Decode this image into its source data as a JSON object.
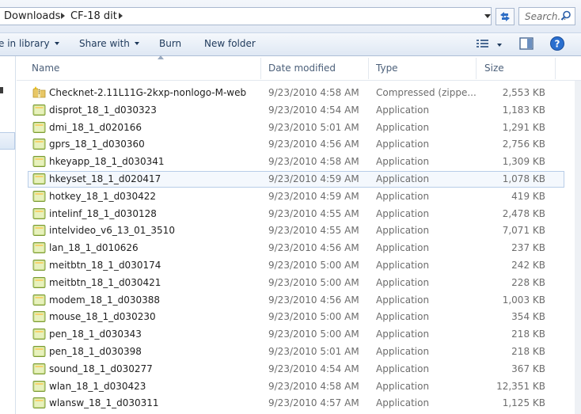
{
  "address": {
    "crumbs": [
      "Downloads",
      "CF-18 dit"
    ]
  },
  "search": {
    "placeholder": "Search..."
  },
  "toolbar": {
    "include_library": "e in library",
    "share_with": "Share with",
    "burn": "Burn",
    "new_folder": "New folder"
  },
  "columns": {
    "name": "Name",
    "date": "Date modified",
    "type": "Type",
    "size": "Size"
  },
  "files": [
    {
      "name": "Checknet-2.11L11G-2kxp-nonlogo-M-web",
      "date": "9/23/2010 4:58 AM",
      "type": "Compressed (zippe...",
      "size": "2,553 KB",
      "icon": "zip-folder-icon"
    },
    {
      "name": "disprot_18_1_d030323",
      "date": "9/23/2010 4:54 AM",
      "type": "Application",
      "size": "1,183 KB",
      "icon": "application-icon"
    },
    {
      "name": "dmi_18_1_d020166",
      "date": "9/23/2010 5:01 AM",
      "type": "Application",
      "size": "1,291 KB",
      "icon": "application-icon"
    },
    {
      "name": "gprs_18_1_d030360",
      "date": "9/23/2010 4:56 AM",
      "type": "Application",
      "size": "2,756 KB",
      "icon": "application-icon"
    },
    {
      "name": "hkeyapp_18_1_d030341",
      "date": "9/23/2010 4:58 AM",
      "type": "Application",
      "size": "1,309 KB",
      "icon": "application-icon"
    },
    {
      "name": "hkeyset_18_1_d020417",
      "date": "9/23/2010 4:59 AM",
      "type": "Application",
      "size": "1,078 KB",
      "icon": "application-icon"
    },
    {
      "name": "hotkey_18_1_d030422",
      "date": "9/23/2010 4:59 AM",
      "type": "Application",
      "size": "419 KB",
      "icon": "application-icon"
    },
    {
      "name": "intelinf_18_1_d030128",
      "date": "9/23/2010 4:55 AM",
      "type": "Application",
      "size": "2,478 KB",
      "icon": "application-icon"
    },
    {
      "name": "intelvideo_v6_13_01_3510",
      "date": "9/23/2010 4:55 AM",
      "type": "Application",
      "size": "7,071 KB",
      "icon": "application-icon"
    },
    {
      "name": "lan_18_1_d010626",
      "date": "9/23/2010 4:56 AM",
      "type": "Application",
      "size": "237 KB",
      "icon": "application-icon"
    },
    {
      "name": "meitbtn_18_1_d030174",
      "date": "9/23/2010 5:00 AM",
      "type": "Application",
      "size": "242 KB",
      "icon": "application-icon"
    },
    {
      "name": "meitbtn_18_1_d030421",
      "date": "9/23/2010 5:00 AM",
      "type": "Application",
      "size": "228 KB",
      "icon": "application-icon"
    },
    {
      "name": "modem_18_1_d030388",
      "date": "9/23/2010 4:56 AM",
      "type": "Application",
      "size": "1,003 KB",
      "icon": "application-icon"
    },
    {
      "name": "mouse_18_1_d030230",
      "date": "9/23/2010 5:00 AM",
      "type": "Application",
      "size": "354 KB",
      "icon": "application-icon"
    },
    {
      "name": "pen_18_1_d030343",
      "date": "9/23/2010 5:00 AM",
      "type": "Application",
      "size": "218 KB",
      "icon": "application-icon"
    },
    {
      "name": "pen_18_1_d030398",
      "date": "9/23/2010 5:01 AM",
      "type": "Application",
      "size": "218 KB",
      "icon": "application-icon"
    },
    {
      "name": "sound_18_1_d030277",
      "date": "9/23/2010 4:54 AM",
      "type": "Application",
      "size": "367 KB",
      "icon": "application-icon"
    },
    {
      "name": "wlan_18_1_d030423",
      "date": "9/23/2010 4:58 AM",
      "type": "Application",
      "size": "12,351 KB",
      "icon": "application-icon"
    },
    {
      "name": "wlansw_18_1_d030311",
      "date": "9/23/2010 4:57 AM",
      "type": "Application",
      "size": "1,125 KB",
      "icon": "application-icon"
    }
  ],
  "selected_index": 5,
  "colors": {
    "toolbar_text": "#1e395b",
    "header_text": "#4c607a",
    "detail_text": "#6d6d6d",
    "selection_border": "#b8cde8",
    "help_blue": "#2a6fcf"
  }
}
